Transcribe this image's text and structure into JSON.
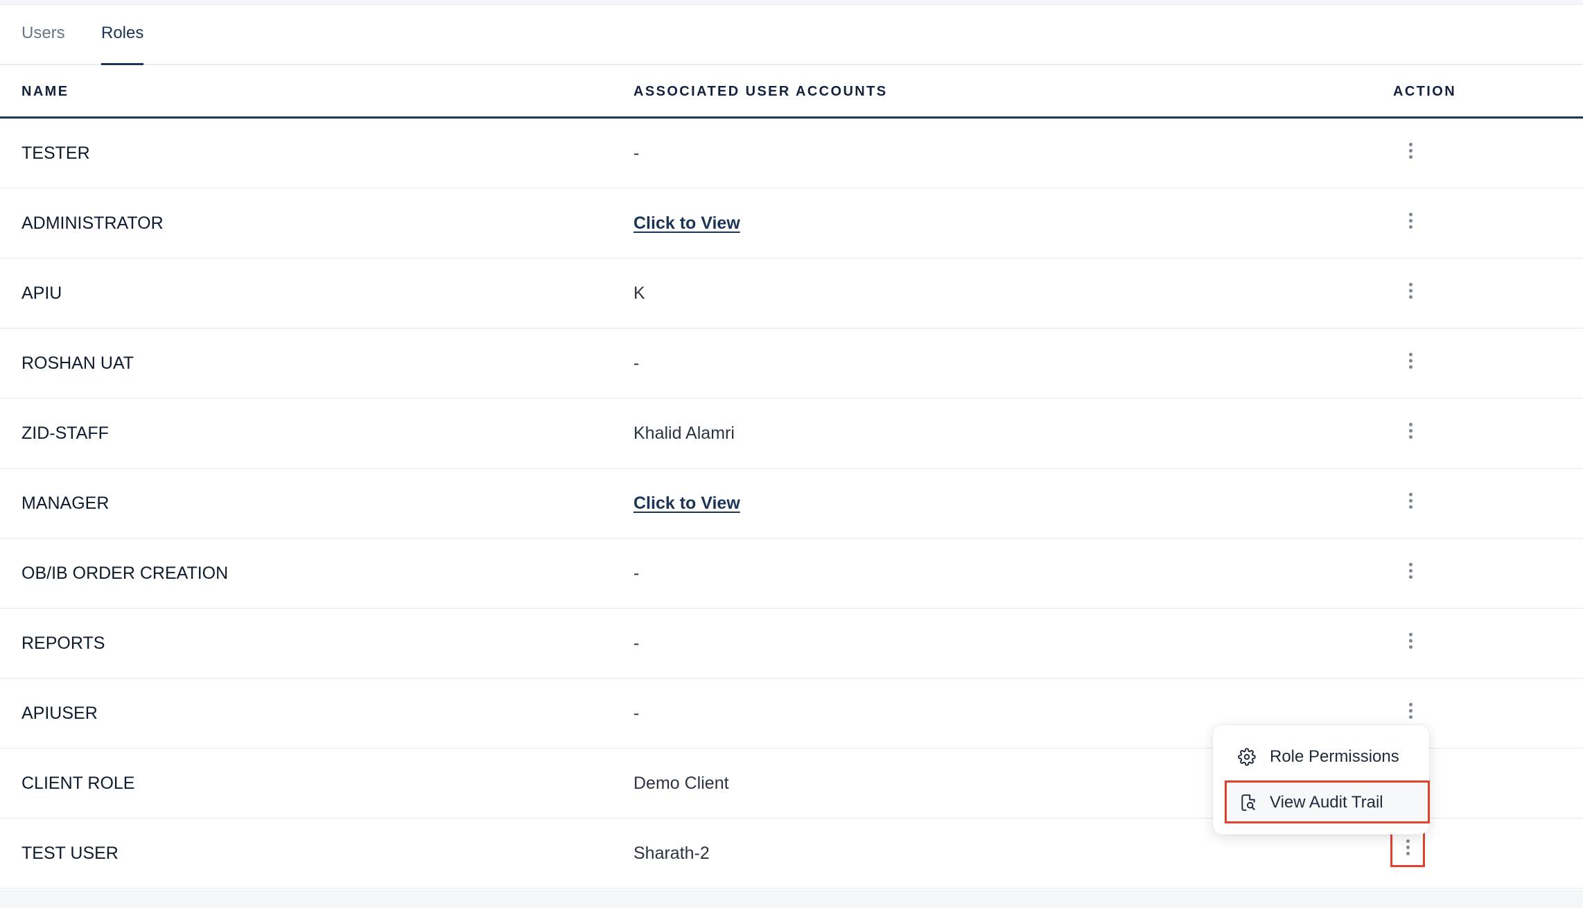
{
  "tabs": [
    {
      "label": "Users",
      "active": false
    },
    {
      "label": "Roles",
      "active": true
    }
  ],
  "table": {
    "headers": {
      "name": "NAME",
      "associated": "ASSOCIATED USER ACCOUNTS",
      "action": "ACTION"
    },
    "rows": [
      {
        "name": "TESTER",
        "associated": "-",
        "link": false
      },
      {
        "name": "ADMINISTRATOR",
        "associated": "Click to View",
        "link": true
      },
      {
        "name": "APIU",
        "associated": "K",
        "link": false
      },
      {
        "name": "ROSHAN UAT",
        "associated": "-",
        "link": false
      },
      {
        "name": "ZID-STAFF",
        "associated": "Khalid Alamri",
        "link": false
      },
      {
        "name": "MANAGER",
        "associated": "Click to View",
        "link": true
      },
      {
        "name": "OB/IB ORDER CREATION",
        "associated": "-",
        "link": false
      },
      {
        "name": "REPORTS",
        "associated": "-",
        "link": false
      },
      {
        "name": "APIUSER",
        "associated": "-",
        "link": false
      },
      {
        "name": "CLIENT ROLE",
        "associated": "Demo Client",
        "link": false
      },
      {
        "name": "TEST USER",
        "associated": "Sharath-2",
        "link": false
      }
    ]
  },
  "action_menu": {
    "items": [
      {
        "label": "Role Permissions",
        "icon": "gear-icon"
      },
      {
        "label": "View Audit Trail",
        "icon": "document-search-icon"
      }
    ]
  },
  "colors": {
    "primary": "#1c3457",
    "highlight": "#e2412b",
    "muted": "#6b7585"
  }
}
